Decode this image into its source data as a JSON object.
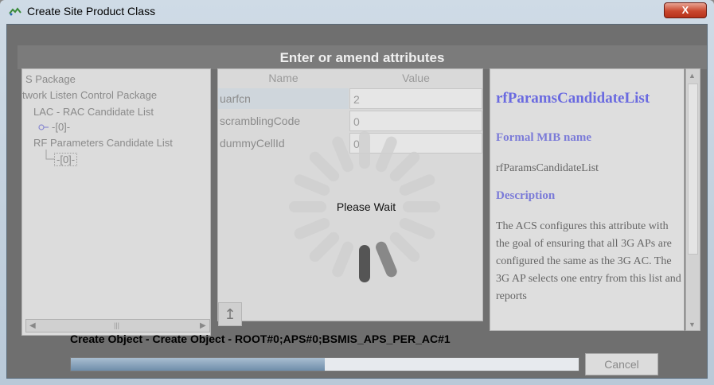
{
  "window": {
    "title": "Create Site Product Class",
    "close_label": "X"
  },
  "header": {
    "title": "Enter or amend attributes"
  },
  "tree": {
    "items": [
      {
        "label": "S Package"
      },
      {
        "label": "twork Listen Control Package"
      },
      {
        "label": "LAC - RAC Candidate List"
      },
      {
        "label": "-[0]-"
      },
      {
        "label": "RF Parameters Candidate List"
      },
      {
        "label": "-[0]-"
      }
    ]
  },
  "table": {
    "columns": [
      "Name",
      "Value"
    ],
    "rows": [
      {
        "name": "uarfcn",
        "value": "2"
      },
      {
        "name": "scramblingCode",
        "value": "0"
      },
      {
        "name": "dummyCellId",
        "value": "0"
      }
    ]
  },
  "help": {
    "title": "rfParamsCandidateList",
    "formal_heading": "Formal MIB name",
    "formal_value": "rfParamsCandidateList",
    "description_heading": "Description",
    "description": "The ACS configures this attribute with the goal of ensuring that all 3G APs are configured the same as the 3G AC. The 3G AP selects one entry from this list and reports"
  },
  "overlay": {
    "wait_text": "Please Wait"
  },
  "progress": {
    "label": "Create Object - Create Object - ROOT#0;APS#0;BSMIS_APS_PER_AC#1",
    "fraction": 0.5,
    "cancel_label": "Cancel"
  },
  "icons": {
    "app": "app-icon",
    "close": "close-icon",
    "up": "up-arrow-icon",
    "spinner": "loading-spinner-icon"
  }
}
